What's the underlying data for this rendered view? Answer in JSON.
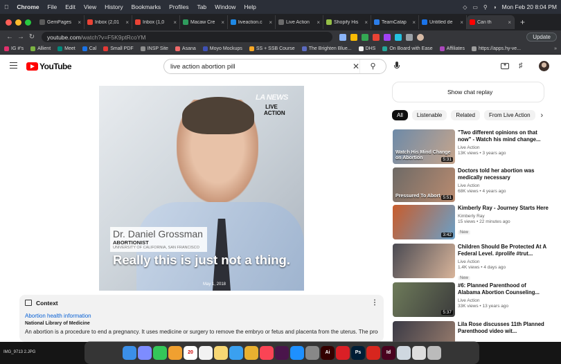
{
  "macos_menubar": {
    "app": "Chrome",
    "menus": [
      "File",
      "Edit",
      "View",
      "History",
      "Bookmarks",
      "Profiles",
      "Tab",
      "Window",
      "Help"
    ],
    "clock": "Mon Feb 20  8:04 PM"
  },
  "browser": {
    "tabs": [
      {
        "label": "GemPages",
        "color": "#5a5a5a",
        "active": false
      },
      {
        "label": "Inbox (2,01",
        "color": "#ea4335",
        "active": false
      },
      {
        "label": "Inbox (1,0",
        "color": "#ea4335",
        "active": false
      },
      {
        "label": "Macaw Cre",
        "color": "#2e9b5c",
        "active": false
      },
      {
        "label": "liveaction.c",
        "color": "#1e88e5",
        "active": false
      },
      {
        "label": "Live Action",
        "color": "#6b6b6b",
        "active": false
      },
      {
        "label": "Shopify His",
        "color": "#95bf47",
        "active": false
      },
      {
        "label": "TeamCatap",
        "color": "#2b7de9",
        "active": false
      },
      {
        "label": "Untitled de",
        "color": "#1a73e8",
        "active": false
      },
      {
        "label": "Can th",
        "color": "#ff0000",
        "active": true
      }
    ],
    "url": {
      "host": "youtube.com",
      "path": "/watch?v=F5K9ptRcoYM"
    },
    "update_label": "Update",
    "bookmarks": [
      {
        "label": "IG #'s",
        "color": "#e1306c"
      },
      {
        "label": "Allient",
        "color": "#7cb342"
      },
      {
        "label": "Meet",
        "color": "#00897b"
      },
      {
        "label": "Cal",
        "color": "#1a73e8"
      },
      {
        "label": "Small PDF",
        "color": "#e53935"
      },
      {
        "label": "INSP Site",
        "color": "#8e8e8e"
      },
      {
        "label": "Asana",
        "color": "#f06a6a"
      },
      {
        "label": "Moyo Mockups",
        "color": "#3f51b5"
      },
      {
        "label": "SS + SSB Course",
        "color": "#f9a825"
      },
      {
        "label": "The Brighten Blue...",
        "color": "#5c6bc0"
      },
      {
        "label": "DHS",
        "color": "#eeeeee"
      },
      {
        "label": "On Board with Ease",
        "color": "#26a69a"
      },
      {
        "label": "Affiliates",
        "color": "#ab47bc"
      },
      {
        "label": "https://apps.hy-ve...",
        "color": "#9e9e9e"
      }
    ],
    "bookmarks_more": "»"
  },
  "youtube": {
    "logo": "YouTube",
    "search_value": "live action abortion pill",
    "video": {
      "brand": "LA NEWS",
      "person_name": "Dr. Daniel Grossman",
      "person_role": "ABORTIONIST",
      "person_org": "UNIVERSITY OF CALIFORNIA, SAN FRANCISCO",
      "caption": "Really this is just not a thing.",
      "date": "May 1, 2018",
      "live_logo": "LIVE ACTION"
    },
    "context": {
      "header": "Context",
      "link": "Abortion health information",
      "source": "National Library of Medicine",
      "body": "An abortion is a procedure to end a pregnancy. It uses medicine or surgery to remove the embryo or fetus and placenta from the uterus. The procedure is"
    },
    "show_chat_replay": "Show chat replay",
    "chips": [
      "All",
      "Listenable",
      "Related",
      "From Live Action"
    ],
    "recommendations": [
      {
        "title": "\"Two different opinions on that now\" - Watch his mind change...",
        "channel": "Live Action",
        "meta": "13K views • 3 years ago",
        "duration": "5:31",
        "thumb_text": "Watch His Mind Change on Abortion",
        "colors": [
          "#6d8aa8",
          "#c6a58c"
        ],
        "new": false
      },
      {
        "title": "Doctors told her abortion was medically necessary",
        "channel": "Live Action",
        "meta": "68K views • 4 years ago",
        "duration": "5:51",
        "thumb_text": "Pressured To Abort",
        "colors": [
          "#6e6a66",
          "#b98b70"
        ],
        "new": false
      },
      {
        "title": "Kimberly Ray - Journey Starts Here",
        "channel": "Kimberly Ray",
        "meta": "15 views • 22 minutes ago",
        "duration": "3:42",
        "thumb_text": "",
        "colors": [
          "#c85c2c",
          "#6aa0c8"
        ],
        "new": true
      },
      {
        "title": "Children Should Be Protected At A Federal Level. #prolife #trut...",
        "channel": "Live Action",
        "meta": "1.4K views • 4 days ago",
        "duration": "",
        "thumb_text": "",
        "colors": [
          "#4a4a52",
          "#d8b49a"
        ],
        "new": true
      },
      {
        "title": "#6: Planned Parenthood of Alabama Abortion Counseling...",
        "channel": "Live Action",
        "meta": "33K views • 13 years ago",
        "duration": "5:37",
        "thumb_text": "",
        "colors": [
          "#6e7b5a",
          "#3c3c3c"
        ],
        "new": false
      },
      {
        "title": "Lila Rose discusses 11th Planned Parenthood video wit...",
        "channel": "",
        "meta": "",
        "duration": "",
        "thumb_text": "",
        "colors": [
          "#3b3b46",
          "#9b7e6e"
        ],
        "new": false
      }
    ],
    "new_label": "New"
  },
  "desktop": {
    "file_label": "IMG_9713 2.JPG",
    "dock": [
      {
        "name": "finder-icon",
        "color": "#3b8fe8",
        "text": ""
      },
      {
        "name": "launchpad-icon",
        "color": "#7d8cff",
        "text": ""
      },
      {
        "name": "messages-icon",
        "color": "#34c759",
        "text": ""
      },
      {
        "name": "photos-icon",
        "color": "#f0a030",
        "text": ""
      },
      {
        "name": "calendar-icon",
        "color": "#ffffff",
        "text": "20"
      },
      {
        "name": "reminders-icon",
        "color": "#f2f2f2",
        "text": ""
      },
      {
        "name": "notes-icon",
        "color": "#f7d774",
        "text": ""
      },
      {
        "name": "safari-icon",
        "color": "#3aa0f0",
        "text": ""
      },
      {
        "name": "chrome-icon",
        "color": "#e8b030",
        "text": ""
      },
      {
        "name": "music-icon",
        "color": "#fa4455",
        "text": ""
      },
      {
        "name": "slack-icon",
        "color": "#4a154b",
        "text": ""
      },
      {
        "name": "app-store-icon",
        "color": "#1e90ff",
        "text": ""
      },
      {
        "name": "system-settings-icon",
        "color": "#888888",
        "text": ""
      },
      {
        "name": "illustrator-icon",
        "color": "#330000",
        "text": "Ai"
      },
      {
        "name": "creative-cloud-icon",
        "color": "#da1f26",
        "text": ""
      },
      {
        "name": "photoshop-icon",
        "color": "#001e36",
        "text": "Ps"
      },
      {
        "name": "acrobat-icon",
        "color": "#d7261e",
        "text": ""
      },
      {
        "name": "indesign-icon",
        "color": "#49021f",
        "text": "Id"
      },
      {
        "name": "preview-icon",
        "color": "#cfd8e0",
        "text": ""
      },
      {
        "name": "screenshot-icon",
        "color": "#dddddd",
        "text": ""
      },
      {
        "name": "trash-icon",
        "color": "#bbbbbb",
        "text": ""
      }
    ]
  }
}
